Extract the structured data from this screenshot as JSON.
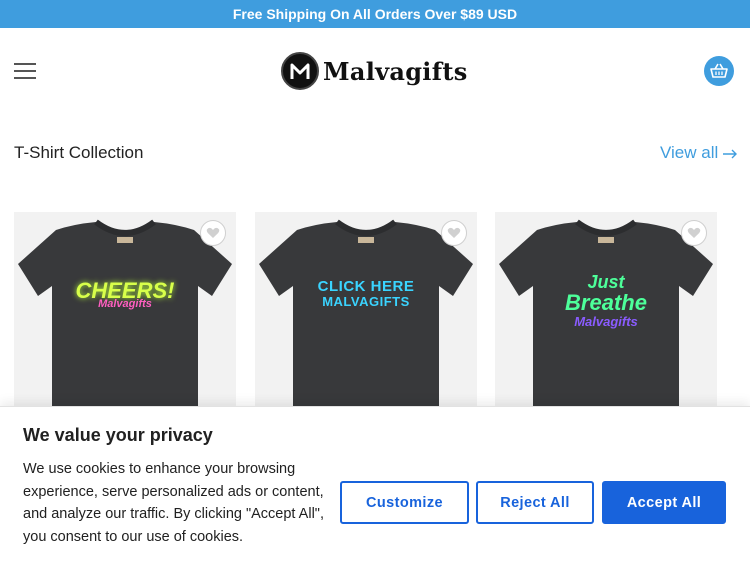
{
  "announcement": "Free Shipping On All Orders Over $89 USD",
  "header": {
    "logo_text": "Malvagifts",
    "menu_icon": "hamburger-menu-icon",
    "cart_icon": "basket-icon"
  },
  "collection": {
    "title": "T-Shirt Collection",
    "view_all": "View all"
  },
  "products": [
    {
      "print_line1": "CHEERS!",
      "print_line2": "Malvagifts"
    },
    {
      "print_line1": "CLICK HERE",
      "print_line2": "MALVAGIFTS"
    },
    {
      "print_line1": "Just",
      "print_line2": "Breathe",
      "print_line3": "Malvagifts"
    }
  ],
  "cookie_banner": {
    "title": "We value your privacy",
    "text": "We use cookies to enhance your browsing experience, serve personalized ads or content, and analyze our traffic. By clicking \"Accept All\", you consent to our use of cookies.",
    "customize": "Customize",
    "reject_all": "Reject All",
    "accept_all": "Accept All"
  },
  "colors": {
    "accent": "#3f9dde",
    "cookie_blue": "#1863dc"
  }
}
